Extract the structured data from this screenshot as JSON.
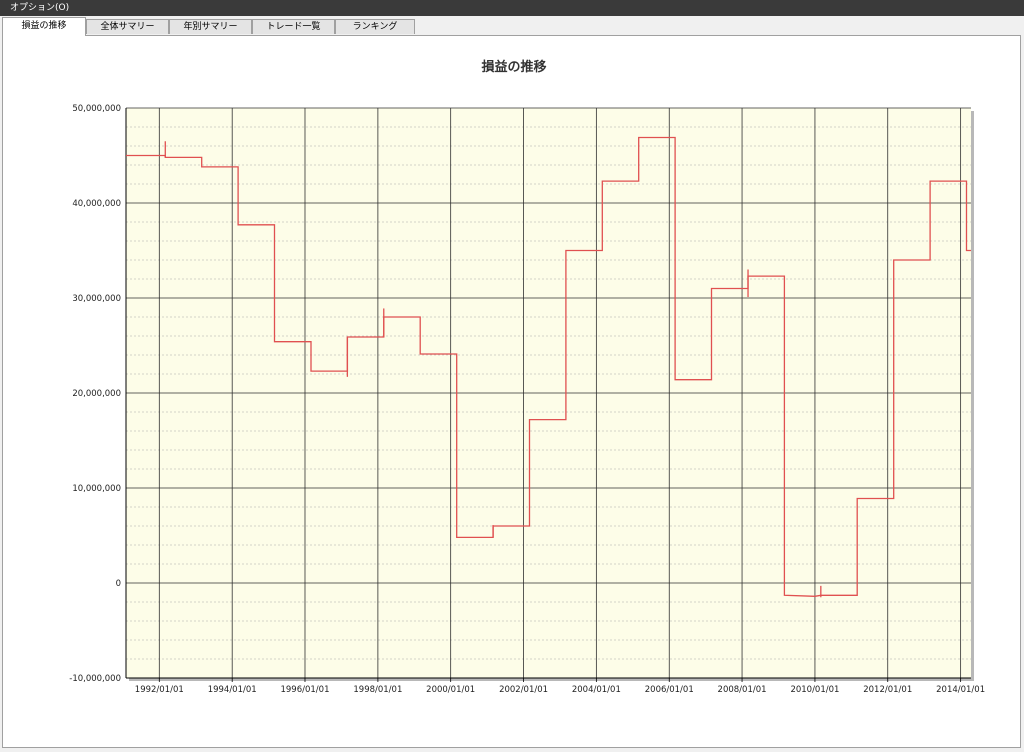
{
  "menu": {
    "options_label": "オプション(O)"
  },
  "tabs": [
    {
      "label": "損益の推移",
      "active": true
    },
    {
      "label": "全体サマリー",
      "active": false
    },
    {
      "label": "年別サマリー",
      "active": false
    },
    {
      "label": "トレード一覧",
      "active": false
    },
    {
      "label": "ランキング",
      "active": false
    }
  ],
  "colors": {
    "plot_background": "#fdfde8",
    "line": "#e05050",
    "major_grid": "#303030",
    "minor_grid": "#a8a8a8"
  },
  "chart_data": {
    "type": "line",
    "title": "損益の推移",
    "xlabel": "",
    "ylabel": "",
    "ylim": [
      -10000000,
      50000000
    ],
    "grid": true,
    "x_tick_labels": [
      "1992/01/01",
      "1994/01/01",
      "1996/01/01",
      "1998/01/01",
      "2000/01/01",
      "2002/01/01",
      "2004/01/01",
      "2006/01/01",
      "2008/01/01",
      "2010/01/01",
      "2012/01/01",
      "2014/01/01"
    ],
    "y_tick_labels": [
      "50,000,000",
      "40,000,000",
      "30,000,000",
      "20,000,000",
      "10,000,000",
      "0",
      "-10,000,000"
    ],
    "series": [
      {
        "points": [
          [
            "1991/02/01",
            45000000
          ],
          [
            "1992/03/01",
            45000000
          ],
          [
            "1992/03/01",
            44800000
          ],
          [
            "1993/03/01",
            44800000
          ],
          [
            "1993/03/01",
            43800000
          ],
          [
            "1994/03/01",
            43800000
          ],
          [
            "1994/03/01",
            37700000
          ],
          [
            "1995/03/01",
            37700000
          ],
          [
            "1995/03/01",
            25400000
          ],
          [
            "1996/03/01",
            25400000
          ],
          [
            "1996/03/01",
            22300000
          ],
          [
            "1997/03/01",
            22300000
          ],
          [
            "1997/03/01",
            25900000
          ],
          [
            "1998/03/01",
            25900000
          ],
          [
            "1998/03/01",
            28000000
          ],
          [
            "1999/03/01",
            28000000
          ],
          [
            "1999/03/01",
            24100000
          ],
          [
            "2000/03/01",
            24100000
          ],
          [
            "2000/03/01",
            4800000
          ],
          [
            "2001/03/01",
            4800000
          ],
          [
            "2001/03/01",
            6000000
          ],
          [
            "2002/03/01",
            6000000
          ],
          [
            "2002/03/01",
            17200000
          ],
          [
            "2003/03/01",
            17200000
          ],
          [
            "2003/03/01",
            35000000
          ],
          [
            "2004/03/01",
            35000000
          ],
          [
            "2004/03/01",
            42300000
          ],
          [
            "2005/03/01",
            42300000
          ],
          [
            "2005/03/01",
            46900000
          ],
          [
            "2006/03/01",
            46900000
          ],
          [
            "2006/03/01",
            21400000
          ],
          [
            "2007/03/01",
            21400000
          ],
          [
            "2007/03/01",
            31000000
          ],
          [
            "2008/03/01",
            31000000
          ],
          [
            "2008/03/01",
            32300000
          ],
          [
            "2009/03/01",
            32300000
          ],
          [
            "2009/03/01",
            -1300000
          ],
          [
            "2010/01/01",
            -1400000
          ],
          [
            "2010/03/01",
            -1300000
          ],
          [
            "2011/03/01",
            -1300000
          ],
          [
            "2011/03/01",
            8900000
          ],
          [
            "2012/03/01",
            8900000
          ],
          [
            "2012/03/01",
            34000000
          ],
          [
            "2013/03/01",
            34000000
          ],
          [
            "2013/03/01",
            42300000
          ],
          [
            "2014/03/01",
            42300000
          ],
          [
            "2014/03/01",
            35000000
          ],
          [
            "2014/04/15",
            35000000
          ]
        ]
      }
    ],
    "spikes": [
      {
        "date": "1992/03/01",
        "low": 44800000,
        "high": 46500000
      },
      {
        "date": "1997/03/01",
        "low": 21700000,
        "high": 25900000
      },
      {
        "date": "1998/03/01",
        "low": 25900000,
        "high": 28900000
      },
      {
        "date": "2001/03/01",
        "low": 4800000,
        "high": 6100000
      },
      {
        "date": "2008/03/01",
        "low": 30100000,
        "high": 33000000
      },
      {
        "date": "2010/03/01",
        "low": -1500000,
        "high": -300000
      }
    ]
  }
}
